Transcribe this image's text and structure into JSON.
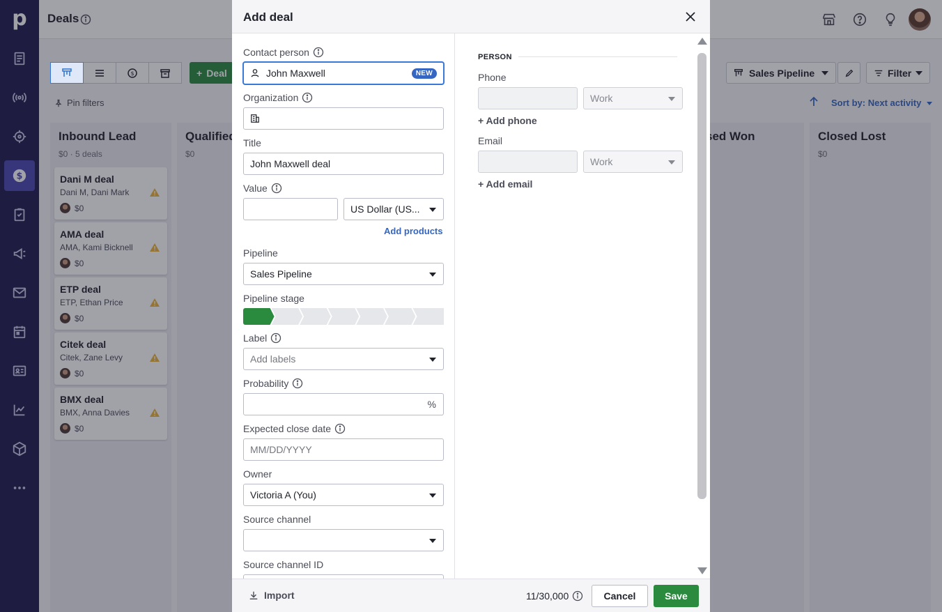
{
  "app": {
    "page_title": "Deals",
    "nav_logo": "p"
  },
  "toolbar": {
    "add_deal_label": "Deal",
    "pipeline_label": "Sales Pipeline",
    "filter_label": "Filter",
    "pin_filters_label": "Pin filters",
    "sort_label": "Sort by: Next activity"
  },
  "columns": [
    {
      "name": "Inbound Lead",
      "summary": "$0 · 5 deals",
      "cards": [
        {
          "title": "Dani M deal",
          "subtitle": "Dani M, Dani Mark",
          "value": "$0"
        },
        {
          "title": "AMA deal",
          "subtitle": "AMA, Kami Bicknell",
          "value": "$0"
        },
        {
          "title": "ETP deal",
          "subtitle": "ETP, Ethan Price",
          "value": "$0"
        },
        {
          "title": "Citek deal",
          "subtitle": "Citek, Zane Levy",
          "value": "$0"
        },
        {
          "title": "BMX deal",
          "subtitle": "BMX, Anna Davies",
          "value": "$0"
        }
      ]
    },
    {
      "name": "Qualified",
      "summary": "$0"
    },
    {
      "name": "sed Won",
      "summary": ""
    },
    {
      "name": "Closed Lost",
      "summary": "$0"
    }
  ],
  "modal": {
    "title": "Add deal",
    "fields": {
      "contact_person_label": "Contact person",
      "contact_person_value": "John Maxwell",
      "contact_new_badge": "NEW",
      "organization_label": "Organization",
      "organization_value": "",
      "title_label": "Title",
      "title_value": "John Maxwell deal",
      "value_label": "Value",
      "value_amount": "",
      "currency_value": "US Dollar (US...",
      "add_products_label": "Add products",
      "pipeline_label": "Pipeline",
      "pipeline_value": "Sales Pipeline",
      "pipeline_stage_label": "Pipeline stage",
      "pipeline_stage_active": 1,
      "pipeline_stage_total": 7,
      "label_label": "Label",
      "label_placeholder": "Add labels",
      "probability_label": "Probability",
      "probability_value": "",
      "probability_suffix": "%",
      "close_date_label": "Expected close date",
      "close_date_placeholder": "MM/DD/YYYY",
      "owner_label": "Owner",
      "owner_value": "Victoria A (You)",
      "source_channel_label": "Source channel",
      "source_channel_value": "",
      "source_channel_id_label": "Source channel ID"
    },
    "person": {
      "section_label": "PERSON",
      "phone_label": "Phone",
      "phone_type": "Work",
      "add_phone_label": "+ Add phone",
      "email_label": "Email",
      "email_type": "Work",
      "add_email_label": "+ Add email"
    },
    "footer": {
      "import_label": "Import",
      "counter": "11/30,000",
      "cancel_label": "Cancel",
      "save_label": "Save"
    }
  },
  "colors": {
    "nav_bg": "#1e1c4f",
    "nav_active": "#4a48b0",
    "primary_green": "#2a8b3f",
    "link_blue": "#3466c2",
    "focus_blue": "#3778d8"
  }
}
